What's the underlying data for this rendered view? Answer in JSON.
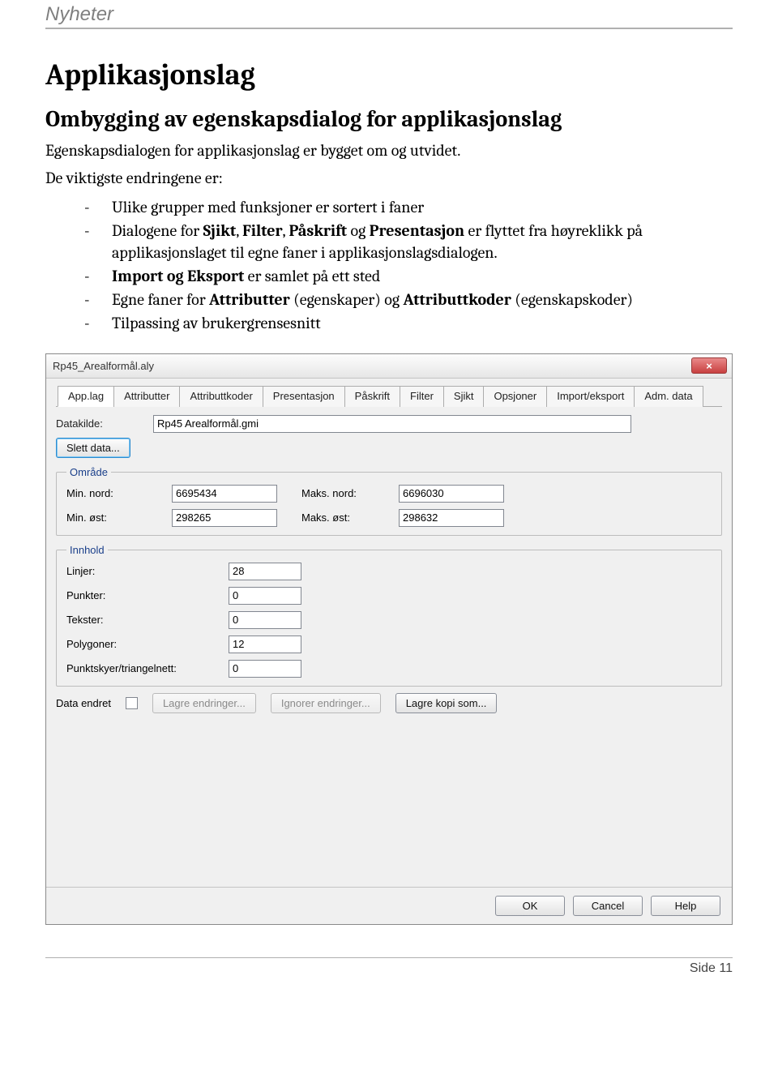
{
  "header": {
    "title": "Nyheter"
  },
  "h1": "Applikasjonslag",
  "h2": "Ombygging av egenskapsdialog for applikasjonslag",
  "intro": "Egenskapsdialogen for applikasjonslag er bygget om og utvidet.",
  "lead": "De viktigste endringene er:",
  "bullets": [
    {
      "pre": "Ulike grupper med funksjoner er sortert i faner"
    },
    {
      "pre": "Dialogene for ",
      "bold": "Sjikt",
      "mid1": ", ",
      "bold2": "Filter",
      "mid2": ", ",
      "bold3": "Påskrift",
      "mid3": " og ",
      "bold4": "Presentasjon",
      "post": " er flyttet fra høyreklikk på applikasjonslaget til egne faner i applikasjonslagsdialogen."
    },
    {
      "bold": "Import og Eksport",
      "post": " er samlet på ett sted"
    },
    {
      "pre": "Egne faner for ",
      "bold": "Attributter",
      "mid1": " (egenskaper) og ",
      "bold2": "Attributtkoder",
      "post": " (egenskapskoder)"
    },
    {
      "pre": "Tilpassing av brukergrensesnitt"
    }
  ],
  "dialog": {
    "title": "Rp45_Arealformål.aly",
    "close": "×",
    "tabs": [
      {
        "label": "App.lag",
        "active": true
      },
      {
        "label": "Attributter"
      },
      {
        "label": "Attributtkoder"
      },
      {
        "label": "Presentasjon"
      },
      {
        "label": "Påskrift"
      },
      {
        "label": "Filter"
      },
      {
        "label": "Sjikt"
      },
      {
        "label": "Opsjoner"
      },
      {
        "label": "Import/eksport"
      },
      {
        "label": "Adm. data"
      }
    ],
    "datakilde_label": "Datakilde:",
    "datakilde_value": "Rp45 Arealformål.gmi",
    "slett_data": "Slett data...",
    "omrade": {
      "legend": "Område",
      "min_nord_label": "Min. nord:",
      "min_nord": "6695434",
      "maks_nord_label": "Maks. nord:",
      "maks_nord": "6696030",
      "min_ost_label": "Min. øst:",
      "min_ost": "298265",
      "maks_ost_label": "Maks. øst:",
      "maks_ost": "298632"
    },
    "innhold": {
      "legend": "Innhold",
      "linjer_label": "Linjer:",
      "linjer": "28",
      "punkter_label": "Punkter:",
      "punkter": "0",
      "tekster_label": "Tekster:",
      "tekster": "0",
      "polygoner_label": "Polygoner:",
      "polygoner": "12",
      "punktskyer_label": "Punktskyer/triangelnett:",
      "punktskyer": "0"
    },
    "data_endret_label": "Data endret",
    "lagre_endringer": "Lagre endringer...",
    "ignorer_endringer": "Ignorer endringer...",
    "lagre_kopi": "Lagre kopi som...",
    "footer": {
      "ok": "OK",
      "cancel": "Cancel",
      "help": "Help"
    }
  },
  "footer": {
    "side_label": "Side",
    "page_number": "11"
  }
}
